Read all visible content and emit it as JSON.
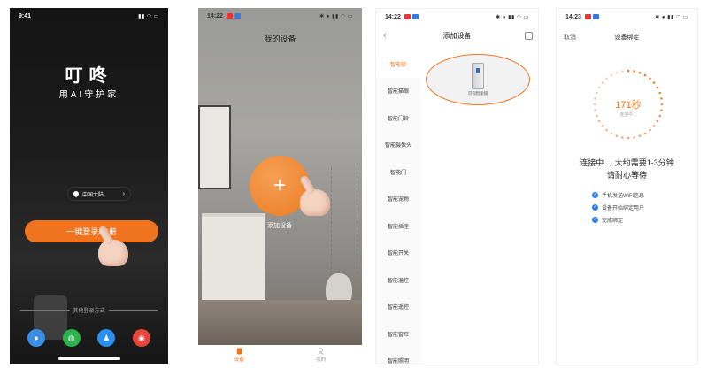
{
  "screen1": {
    "status_time": "9:41",
    "brand_name": "叮咚",
    "slogan": "用AI守护家",
    "region": "中国大陆",
    "login_button": "一键登录/注册",
    "other_login": "其他登录方式"
  },
  "screen2": {
    "status_time": "14:22",
    "title": "我的设备",
    "add_device": "添加设备",
    "tabs": [
      {
        "label": "设备"
      },
      {
        "label": "我的"
      }
    ]
  },
  "screen3": {
    "status_time": "14:22",
    "title": "添加设备",
    "categories": [
      {
        "label": "智能锁"
      },
      {
        "label": "智能猫眼"
      },
      {
        "label": "智能门铃"
      },
      {
        "label": "智能摄像头"
      },
      {
        "label": "智能门"
      },
      {
        "label": "智能宠物"
      },
      {
        "label": "智能插座"
      },
      {
        "label": "智能开关"
      },
      {
        "label": "智能温控"
      },
      {
        "label": "智能遥控"
      },
      {
        "label": "智能窗帘"
      },
      {
        "label": "智能照明"
      }
    ],
    "product_name": "可视智能锁"
  },
  "screen4": {
    "status_time": "14:23",
    "cancel": "取消",
    "title": "设备绑定",
    "countdown": "171秒",
    "connecting_short": "连接中...",
    "message_line1": "连接中.....大约需要1-3分钟",
    "message_line2": "请耐心等待",
    "steps": [
      {
        "label": "手机发送WiFi信息"
      },
      {
        "label": "设备开始绑定用户"
      },
      {
        "label": "完成绑定"
      }
    ]
  },
  "colors": {
    "accent": "#f07420",
    "check_blue": "#2d7ee8"
  }
}
